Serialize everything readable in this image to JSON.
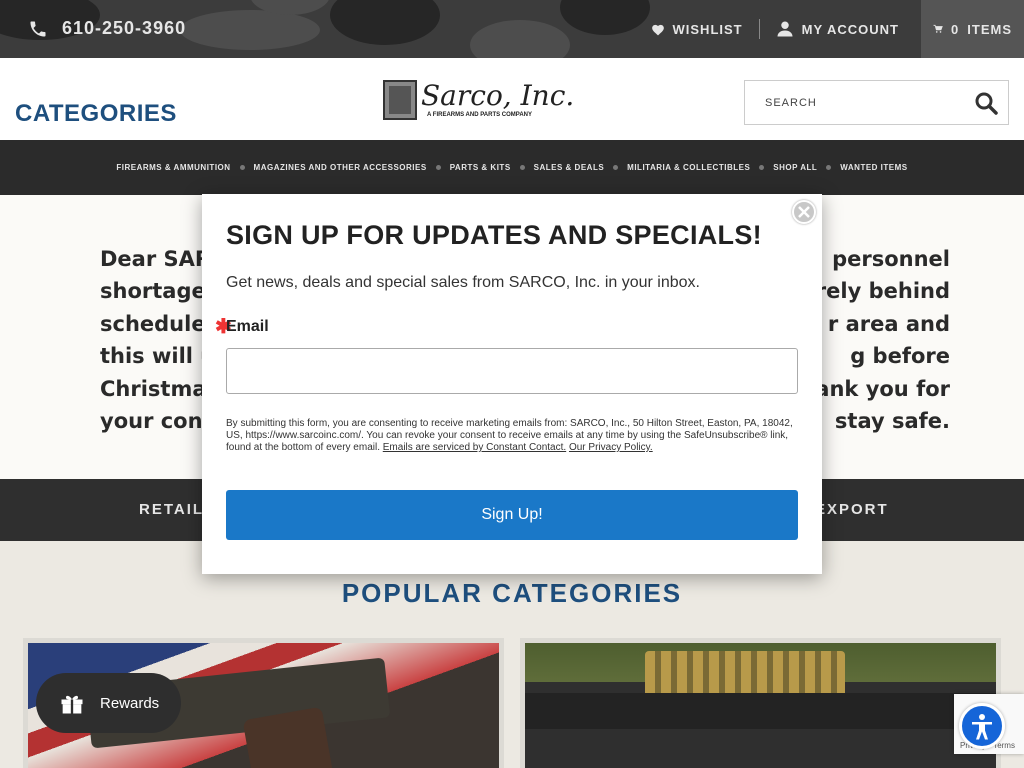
{
  "topbar": {
    "phone": "610-250-3960",
    "wishlist": "WISHLIST",
    "account": "MY ACCOUNT",
    "cart_count": "0",
    "cart_label": "ITEMS"
  },
  "header": {
    "categories": "CATEGORIES",
    "logo_main": "Sarco, Inc.",
    "logo_sub": "A FIREARMS AND PARTS COMPANY",
    "search_placeholder": "SEARCH"
  },
  "nav": {
    "items": [
      {
        "label": "FIREARMS & AMMUNITION"
      },
      {
        "label": "MAGAZINES AND OTHER ACCESSORIES"
      },
      {
        "label": "PARTS & KITS"
      },
      {
        "label": "SALES & DEALS"
      },
      {
        "label": "MILITARIA & COLLECTIBLES"
      },
      {
        "label": "SHOP ALL"
      },
      {
        "label": "WANTED ITEMS"
      }
    ]
  },
  "banner": {
    "line1_left": "Dear SARC",
    "line1_right": "personnel",
    "line2_left": "shortages",
    "line2_right": "rely behind",
    "line3_left": "schedule.",
    "line3_right": "r area and",
    "line4_left": "this will u",
    "line4_right": "g before",
    "line5_left": "Christmas",
    "line5_right": "ank you for",
    "line6_left": "your conti",
    "line6_right": "stay safe."
  },
  "strip": {
    "left": "RETAIL",
    "right": "EXPORT"
  },
  "popular": {
    "title": "POPULAR CATEGORIES"
  },
  "modal": {
    "title": "SIGN UP FOR UPDATES AND SPECIALS!",
    "subtitle": "Get news, deals and special sales from SARCO, Inc. in your inbox.",
    "required_mark": "✱",
    "email_label": "Email",
    "legal_text": "By submitting this form, you are consenting to receive marketing emails from: SARCO, Inc., 50 Hilton Street, Easton, PA, 18042, US, https://www.sarcoinc.com/. You can revoke your consent to receive emails at any time by using the SafeUnsubscribe® link, found at the bottom of every email.",
    "legal_link1": "Emails are serviced by Constant Contact.",
    "legal_link2": "Our Privacy Policy.",
    "signup_label": "Sign Up!"
  },
  "rewards": {
    "label": "Rewards"
  },
  "recaptcha": {
    "terms": "Privacy - Terms"
  },
  "colors": {
    "accent_blue": "#1e4f7e",
    "button_blue": "#1a78c8",
    "dark_bar": "#2b2b2b"
  },
  "icons": {
    "phone": "phone-icon",
    "wishlist": "heart-icon",
    "account": "user-icon",
    "cart": "cart-icon",
    "search": "search-icon",
    "close": "close-icon",
    "rewards": "gift-icon",
    "accessibility": "accessibility-icon"
  }
}
